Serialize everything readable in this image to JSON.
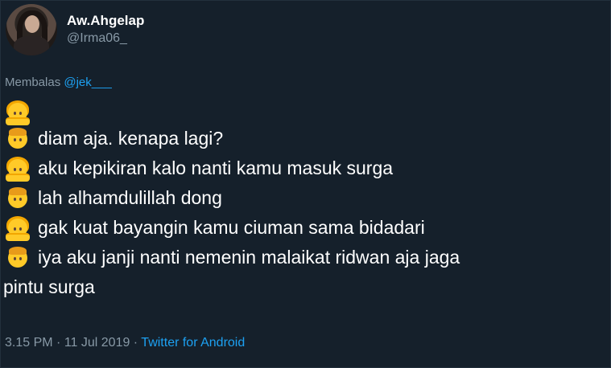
{
  "author": {
    "display_name": "Aw.Ahgelap",
    "handle": "@Irma06_"
  },
  "reply": {
    "prefix": "Membalas",
    "mention": "@jek___"
  },
  "lines": [
    {
      "emoji": "woman-gesturing-no-emoji",
      "text": ""
    },
    {
      "emoji": "boy-emoji",
      "text": "diam aja. kenapa lagi?"
    },
    {
      "emoji": "woman-gesturing-no-emoji",
      "text": "aku kepikiran kalo nanti kamu masuk surga"
    },
    {
      "emoji": "boy-emoji",
      "text": "lah alhamdulillah dong"
    },
    {
      "emoji": "woman-gesturing-no-emoji",
      "text": "gak kuat bayangin kamu ciuman sama bidadari"
    },
    {
      "emoji": "boy-emoji",
      "text": "iya aku janji nanti nemenin malaikat ridwan aja jaga"
    }
  ],
  "wrap_continuation": "pintu surga",
  "meta": {
    "time": "3.15 PM",
    "sep1": " · ",
    "date": "11 Jul 2019",
    "sep2": " · ",
    "source": "Twitter for Android"
  },
  "colors": {
    "background": "#15202b",
    "muted": "#8899a6",
    "accent": "#1da1f2",
    "text": "#ffffff"
  }
}
